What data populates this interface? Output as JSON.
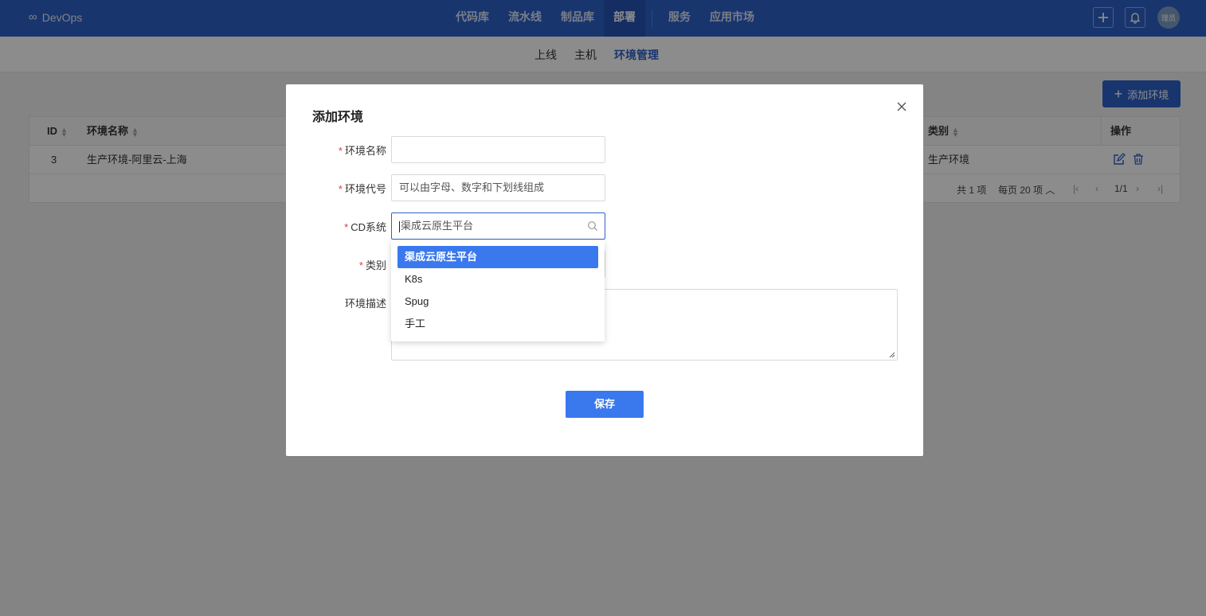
{
  "app": {
    "brand_symbol": "∞",
    "brand_name": "DevOps"
  },
  "nav": {
    "items": [
      "代码库",
      "流水线",
      "制品库",
      "部署",
      "服务",
      "应用市场"
    ],
    "active": "部署"
  },
  "header_icons": {
    "add": "plus-icon",
    "notify": "bell-icon",
    "avatar_text": "理员"
  },
  "subnav": {
    "tabs": [
      "上线",
      "主机",
      "环境管理"
    ],
    "active": "环境管理"
  },
  "page": {
    "add_button_label": "添加环境",
    "table": {
      "columns": {
        "id": "ID",
        "name": "环境名称",
        "category": "类别",
        "actions": "操作"
      },
      "rows": [
        {
          "id": "3",
          "name": "生产环境-阿里云-上海",
          "category": "生产环境"
        }
      ]
    },
    "pagination": {
      "total": "共 1 项",
      "per_page": "每页 20 项",
      "page": "1/1"
    }
  },
  "modal": {
    "title": "添加环境",
    "fields": {
      "name": {
        "label": "环境名称",
        "value": ""
      },
      "code": {
        "label": "环境代号",
        "placeholder": "可以由字母、数字和下划线组成"
      },
      "cd": {
        "label": "CD系统",
        "value": "渠成云原生平台"
      },
      "category": {
        "label": "类别"
      },
      "desc": {
        "label": "环境描述"
      }
    },
    "save_label": "保存",
    "cd_options": [
      "渠成云原生平台",
      "K8s",
      "Spug",
      "手工"
    ],
    "cd_selected_index": 0
  },
  "colors": {
    "nav_bg": "#2f62c9",
    "primary": "#3a78ee",
    "required": "#e03c3c"
  }
}
